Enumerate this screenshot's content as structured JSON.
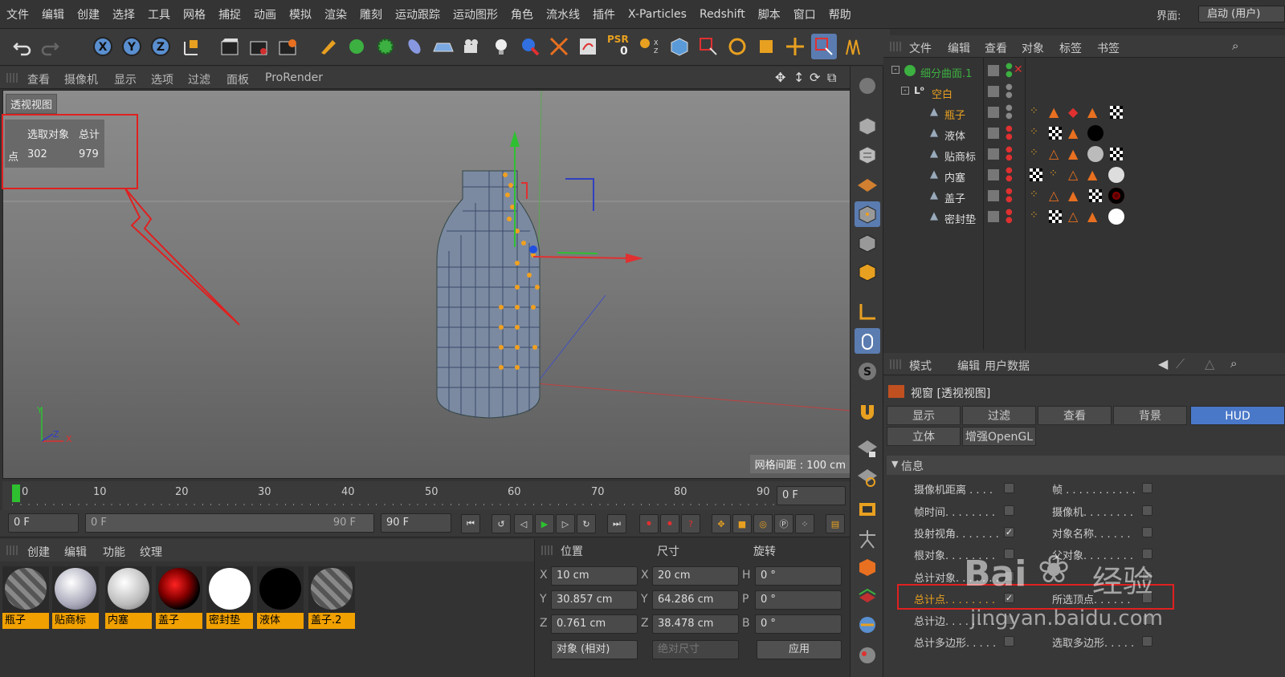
{
  "menu": [
    "文件",
    "编辑",
    "创建",
    "选择",
    "工具",
    "网格",
    "捕捉",
    "动画",
    "模拟",
    "渲染",
    "雕刻",
    "运动跟踪",
    "运动图形",
    "角色",
    "流水线",
    "插件",
    "X-Particles",
    "Redshift",
    "脚本",
    "窗口",
    "帮助"
  ],
  "layout": {
    "label": "界面:",
    "value": "启动 (用户)"
  },
  "toolbar": {
    "psr_label": "PSR",
    "psr_value": "0"
  },
  "viewport": {
    "menus": [
      "查看",
      "摄像机",
      "显示",
      "选项",
      "过滤",
      "面板",
      "ProRender"
    ],
    "title": "透视视图",
    "hud": {
      "col1": "选取对象",
      "col2": "总计",
      "row_label": "点",
      "selected": "302",
      "total": "979"
    },
    "grid_spacing": "网格间距 : 100 cm",
    "axis_y": "Y",
    "axis_z": "Z",
    "axis_x": "X"
  },
  "object_manager": {
    "menus": [
      "文件",
      "编辑",
      "查看",
      "对象",
      "标签",
      "书签"
    ],
    "objects": [
      {
        "name": "细分曲面.1"
      },
      {
        "name": "空白"
      },
      {
        "name": "瓶子"
      },
      {
        "name": "液体"
      },
      {
        "name": "贴商标"
      },
      {
        "name": "内塞"
      },
      {
        "name": "盖子"
      },
      {
        "name": "密封垫"
      }
    ]
  },
  "attributes": {
    "menus": [
      "模式",
      "编辑",
      "用户数据"
    ],
    "header": "视窗 [透视视图]",
    "tabs_row1": [
      "显示",
      "过滤",
      "查看",
      "背景",
      "HUD"
    ],
    "tabs_row2": [
      "立体",
      "增强OpenGL"
    ],
    "section": "信息",
    "left_items": [
      {
        "label": "摄像机距离 . . . .",
        "checked": false
      },
      {
        "label": "帧时间. . . . . . . .",
        "checked": false
      },
      {
        "label": "投射视角. . . . . . .",
        "checked": true
      },
      {
        "label": "根对象. . . . . . . .",
        "checked": false
      },
      {
        "label": "总计对象. . . . . . .",
        "checked": false
      },
      {
        "label": "总计点. . . . . . . .",
        "checked": true
      },
      {
        "label": "总计边. . . . . . . .",
        "checked": false
      },
      {
        "label": "总计多边形. . . . .",
        "checked": false
      }
    ],
    "right_items": [
      {
        "label": "帧 . . . . . . . . . . .",
        "checked": false
      },
      {
        "label": "摄像机. . . . . . . .",
        "checked": false
      },
      {
        "label": "对象名称. . . . . .",
        "checked": false
      },
      {
        "label": "父对象. . . . . . . .",
        "checked": false
      },
      {
        "label": "",
        "checked": false
      },
      {
        "label": "所选顶点. . . . . .",
        "checked": false
      },
      {
        "label": "",
        "checked": false
      },
      {
        "label": "选取多边形. . . . .",
        "checked": false
      }
    ]
  },
  "timeline": {
    "ticks": [
      "0",
      "10",
      "20",
      "30",
      "40",
      "50",
      "60",
      "70",
      "80",
      "90"
    ],
    "current_frame": "0 F",
    "start": "0 F",
    "range_start": "0 F",
    "range_end": "90 F",
    "end": "90 F"
  },
  "materials": {
    "menus": [
      "创建",
      "编辑",
      "功能",
      "纹理"
    ],
    "items": [
      {
        "name": "瓶子",
        "style": "stripe"
      },
      {
        "name": "贴商标",
        "style": "label"
      },
      {
        "name": "内塞",
        "style": "white"
      },
      {
        "name": "盖子",
        "style": "red"
      },
      {
        "name": "密封垫",
        "style": "pure-white"
      },
      {
        "name": "液体",
        "style": "black"
      },
      {
        "name": "盖子.2",
        "style": "stripe"
      }
    ]
  },
  "coordinates": {
    "headers": [
      "位置",
      "尺寸",
      "旋转"
    ],
    "rows": [
      {
        "axis": "X",
        "pos": "10 cm",
        "size_axis": "X",
        "size": "20 cm",
        "rot_axis": "H",
        "rot": "0 °"
      },
      {
        "axis": "Y",
        "pos": "30.857 cm",
        "size_axis": "Y",
        "size": "64.286 cm",
        "rot_axis": "P",
        "rot": "0 °"
      },
      {
        "axis": "Z",
        "pos": "0.761 cm",
        "size_axis": "Z",
        "size": "38.478 cm",
        "rot_axis": "B",
        "rot": "0 °"
      }
    ],
    "mode": "对象 (相对)",
    "size_mode": "绝对尺寸",
    "apply": "应用"
  },
  "watermark": {
    "brand": "Bai",
    "brand2": "经验",
    "url": "jingyan.baidu.com"
  }
}
